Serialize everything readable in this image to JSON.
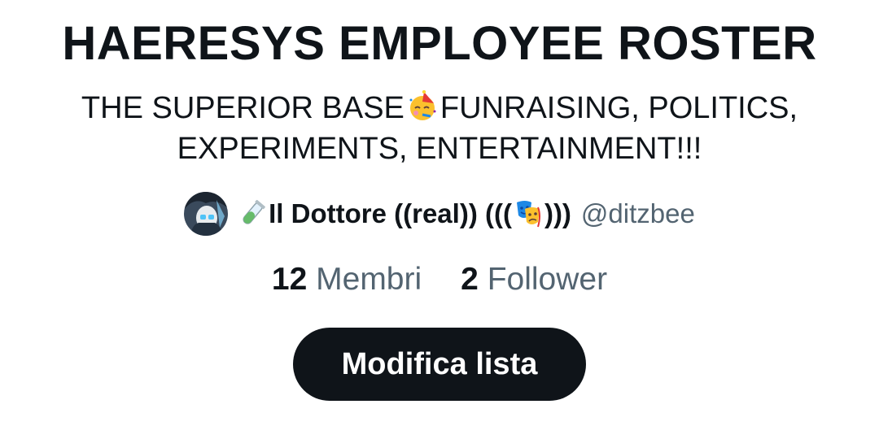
{
  "list": {
    "title": "HAERESYS EMPLOYEE ROSTER",
    "description_line1_a": "THE SUPERIOR BASE",
    "description_line1_b": "FUNRAISING, POLITICS,",
    "description_line2": "EXPERIMENTS, ENTERTAINMENT!!!",
    "party_emoji_icon": "partying-face-icon"
  },
  "owner": {
    "name_a": "Il Dottore ((real)) (((",
    "name_b": ")))",
    "handle": "@ditzbee",
    "test_tube_icon": "test-tube-icon",
    "masks_icon": "performing-arts-icon"
  },
  "stats": {
    "members_count": "12",
    "members_label": "Membri",
    "followers_count": "2",
    "followers_label": "Follower"
  },
  "actions": {
    "edit_label": "Modifica lista"
  },
  "colors": {
    "text": "#0f1419",
    "secondary_text": "#536471",
    "button_bg": "#0f1419",
    "button_text": "#ffffff"
  }
}
